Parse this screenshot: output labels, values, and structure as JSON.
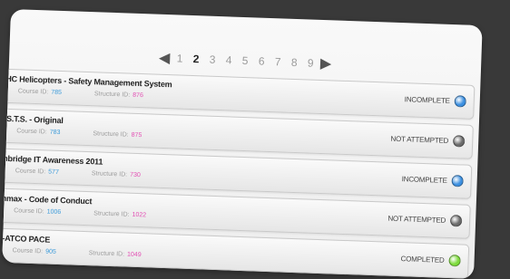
{
  "pager": {
    "prev_icon": "◀",
    "next_icon": "▶",
    "pages": [
      "1",
      "2",
      "3",
      "4",
      "5",
      "6",
      "7",
      "8",
      "9"
    ],
    "current": "2"
  },
  "labels": {
    "course_id": "Course ID:",
    "structure_id": "Structure ID:"
  },
  "status_colors": {
    "INCOMPLETE": "#3b8fe0",
    "NOT ATTEMPTED": "#6b6b6b",
    "COMPLETED": "#7ddb3b"
  },
  "courses": [
    {
      "title": "HC Helicopters - Safety Management System",
      "course_id": "785",
      "structure_id": "876",
      "status": "INCOMPLETE"
    },
    {
      "title": ".S.T.S. - Original",
      "course_id": "783",
      "structure_id": "875",
      "status": "NOT ATTEMPTED"
    },
    {
      "title": "nbridge IT Awareness 2011",
      "course_id": "577",
      "structure_id": "730",
      "status": "INCOMPLETE"
    },
    {
      "title": "nmax - Code of Conduct",
      "course_id": "1006",
      "structure_id": "1022",
      "status": "NOT ATTEMPTED"
    },
    {
      "title": "I-ATCO PACE",
      "course_id": "905",
      "structure_id": "1049",
      "status": "COMPLETED"
    }
  ]
}
